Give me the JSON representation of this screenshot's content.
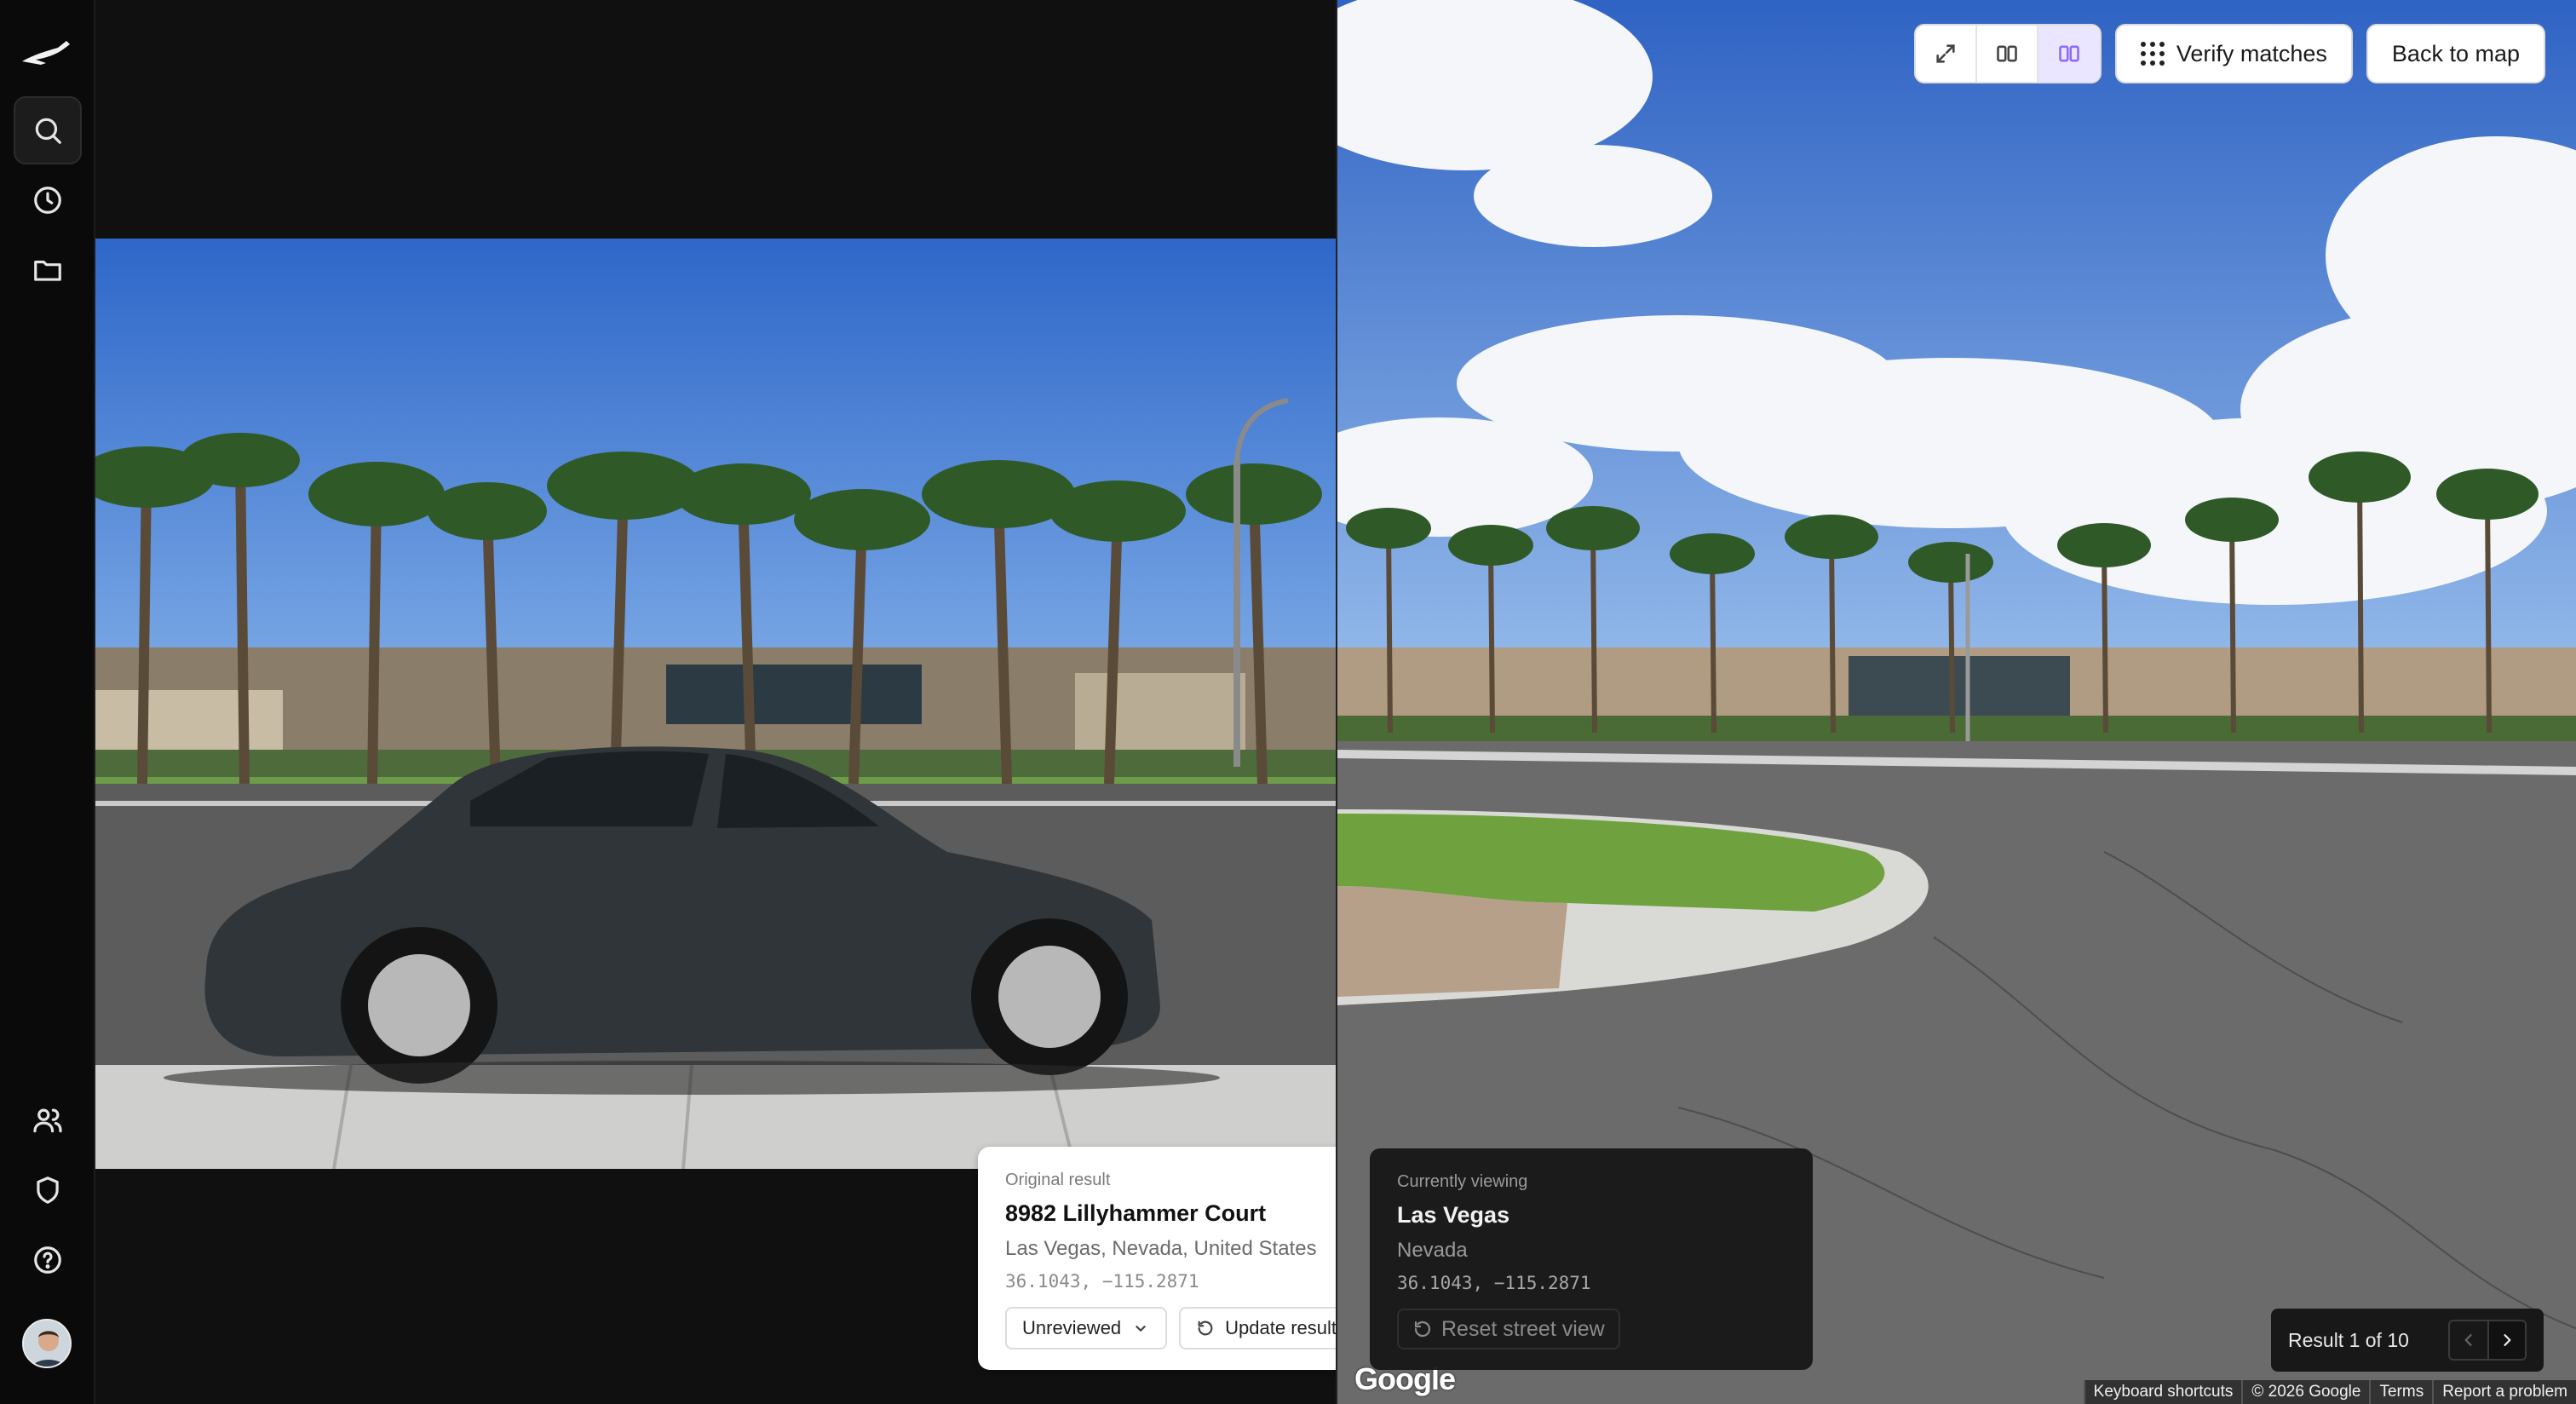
{
  "sidebar": {
    "items": [
      {
        "name": "search"
      },
      {
        "name": "history"
      },
      {
        "name": "folder"
      },
      {
        "name": "users"
      },
      {
        "name": "shield"
      },
      {
        "name": "help"
      }
    ]
  },
  "toolbar": {
    "verify_label": "Verify matches",
    "back_label": "Back to map",
    "view_modes": [
      "expand",
      "split",
      "split-active"
    ]
  },
  "original": {
    "caption": "Original result",
    "address": "8982 Lillyhammer Court",
    "city": "Las Vegas, Nevada, United States",
    "coords": "36.1043, −115.2871",
    "status": "Unreviewed",
    "update_label": "Update result"
  },
  "viewing": {
    "caption": "Currently viewing",
    "city": "Las Vegas",
    "state": "Nevada",
    "coords": "36.1043, −115.2871",
    "reset_label": "Reset street view"
  },
  "pager": {
    "label": "Result 1 of 10"
  },
  "google": {
    "logo": "Google",
    "links": [
      "Keyboard shortcuts",
      "© 2026 Google",
      "Terms",
      "Report a problem"
    ]
  },
  "colors": {
    "accent": "#8b6cf5",
    "accent_bg": "#ebe6ff",
    "dark": "#0a0a0a"
  }
}
